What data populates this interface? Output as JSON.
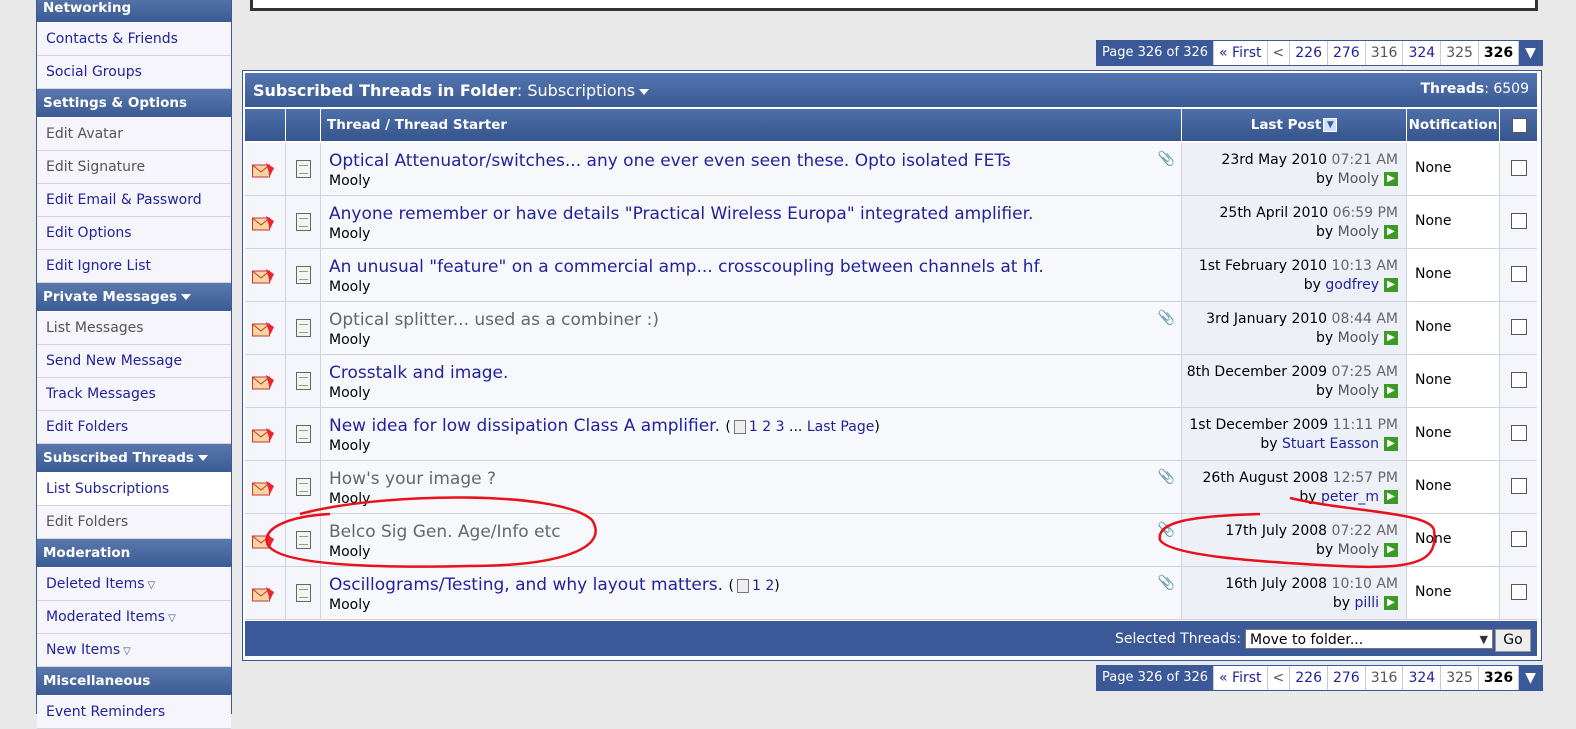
{
  "sidebar": {
    "sections": [
      {
        "title": "Networking",
        "items": [
          {
            "label": "Contacts & Friends"
          },
          {
            "label": "Social Groups"
          }
        ]
      },
      {
        "title": "Settings & Options",
        "items": [
          {
            "label": "Edit Avatar"
          },
          {
            "label": "Edit Signature"
          },
          {
            "label": "Edit Email & Password"
          },
          {
            "label": "Edit Options"
          },
          {
            "label": "Edit Ignore List"
          }
        ]
      },
      {
        "title": "Private Messages",
        "items": [
          {
            "label": "List Messages"
          },
          {
            "label": "Send New Message"
          },
          {
            "label": "Track Messages"
          },
          {
            "label": "Edit Folders"
          }
        ]
      },
      {
        "title": "Subscribed Threads",
        "items": [
          {
            "label": "List Subscriptions"
          },
          {
            "label": "Edit Folders"
          }
        ]
      },
      {
        "title": "Moderation",
        "items": [
          {
            "label": "Deleted Items"
          },
          {
            "label": "Moderated Items"
          },
          {
            "label": "New Items"
          }
        ]
      },
      {
        "title": "Miscellaneous",
        "items": [
          {
            "label": "Event Reminders"
          }
        ]
      }
    ]
  },
  "pager": {
    "info": "Page 326 of 326",
    "first": "« First",
    "prev": "<",
    "pages": [
      "226",
      "276",
      "316",
      "324",
      "325"
    ],
    "current": "326"
  },
  "table": {
    "heading_bold": "Subscribed Threads in Folder",
    "heading_sep": ": ",
    "folder": "Subscriptions",
    "count_label": "Threads",
    "count_value": "6509",
    "col_thread": "Thread / Thread Starter",
    "col_lastpost": "Last Post",
    "col_notification": "Notification",
    "rows": [
      {
        "title": "Optical Attenuator/switches... any one ever even seen these. Opto isolated FETs",
        "starter": "Mooly",
        "date": "23rd May 2010",
        "time": "07:21 AM",
        "by": "by",
        "poster": "Mooly",
        "notif": "None"
      },
      {
        "title": "Anyone remember or have details \"Practical Wireless Europa\" integrated amplifier.",
        "starter": "Mooly",
        "date": "25th April 2010",
        "time": "06:59 PM",
        "by": "by",
        "poster": "Mooly",
        "notif": "None"
      },
      {
        "title": "An unusual \"feature\" on a commercial amp... crosscoupling between channels at hf.",
        "starter": "Mooly",
        "date": "1st February 2010",
        "time": "10:13 AM",
        "by": "by",
        "poster": "godfrey",
        "notif": "None"
      },
      {
        "title": "Optical splitter... used as a combiner :)",
        "starter": "Mooly",
        "date": "3rd January 2010",
        "time": "08:44 AM",
        "by": "by",
        "poster": "Mooly",
        "notif": "None"
      },
      {
        "title": "Crosstalk and image.",
        "starter": "Mooly",
        "date": "8th December 2009",
        "time": "07:25 AM",
        "by": "by",
        "poster": "Mooly",
        "notif": "None"
      },
      {
        "title": "New idea for low dissipation Class A amplifier.",
        "starter": "Mooly",
        "date": "1st December 2009",
        "time": "11:11 PM",
        "by": "by",
        "poster": "Stuart Easson",
        "notif": "None",
        "pages": [
          "1",
          "2",
          "3"
        ],
        "ellipsis": "...",
        "last_page": "Last Page"
      },
      {
        "title": "How's your image ?",
        "starter": "Mooly",
        "date": "26th August 2008",
        "time": "12:57 PM",
        "by": "by",
        "poster": "peter_m",
        "notif": "None"
      },
      {
        "title": "Belco Sig Gen. Age/Info etc",
        "starter": "Mooly",
        "date": "17th July 2008",
        "time": "07:22 AM",
        "by": "by",
        "poster": "Mooly",
        "notif": "None"
      },
      {
        "title": "Oscillograms/Testing, and why layout matters.",
        "starter": "Mooly",
        "date": "16th July 2008",
        "time": "10:10 AM",
        "by": "by",
        "poster": "pilli",
        "notif": "None",
        "pages": [
          "1",
          "2"
        ]
      }
    ],
    "footer_label": "Selected Threads:",
    "footer_select": "Move to folder...",
    "footer_go": "Go"
  },
  "colors": {
    "accent": "#3b5998",
    "link": "#22229c",
    "annotation": "#e8101a"
  }
}
